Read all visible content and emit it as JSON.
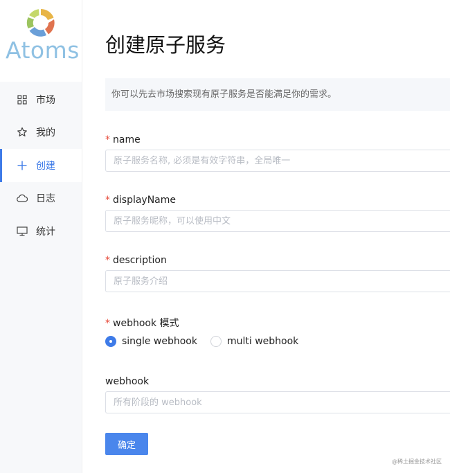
{
  "brand": {
    "logo_text": "Atoms"
  },
  "sidebar": {
    "items": [
      {
        "label": "市场",
        "icon": "grid-icon"
      },
      {
        "label": "我的",
        "icon": "star-icon"
      },
      {
        "label": "创建",
        "icon": "plus-icon",
        "active": true
      },
      {
        "label": "日志",
        "icon": "cloud-icon"
      },
      {
        "label": "统计",
        "icon": "monitor-icon"
      }
    ]
  },
  "page": {
    "title": "创建原子服务",
    "tip": "你可以先去市场搜索现有原子服务是否能满足你的需求。"
  },
  "form": {
    "name": {
      "label": "name",
      "required_mark": "*",
      "placeholder": "原子服务名称, 必须是有效字符串，全局唯一",
      "value": ""
    },
    "display_name": {
      "label": "displayName",
      "required_mark": "*",
      "placeholder": "原子服务昵称，可以使用中文",
      "value": ""
    },
    "description": {
      "label": "description",
      "required_mark": "*",
      "placeholder": "原子服务介绍",
      "value": ""
    },
    "webhook_mode": {
      "label": "webhook 模式",
      "required_mark": "*",
      "options": [
        {
          "label": "single webhook",
          "selected": true
        },
        {
          "label": "multi webhook",
          "selected": false
        }
      ]
    },
    "webhook": {
      "label": "webhook",
      "placeholder": "所有阶段的 webhook",
      "value": ""
    },
    "submit_label": "确定"
  },
  "watermark": "@稀土掘金技术社区",
  "colors": {
    "accent": "#3e7be8",
    "required": "#e74c3c",
    "sidebar_bg": "#f7f8fa",
    "tip_bg": "#f5f7fa"
  }
}
